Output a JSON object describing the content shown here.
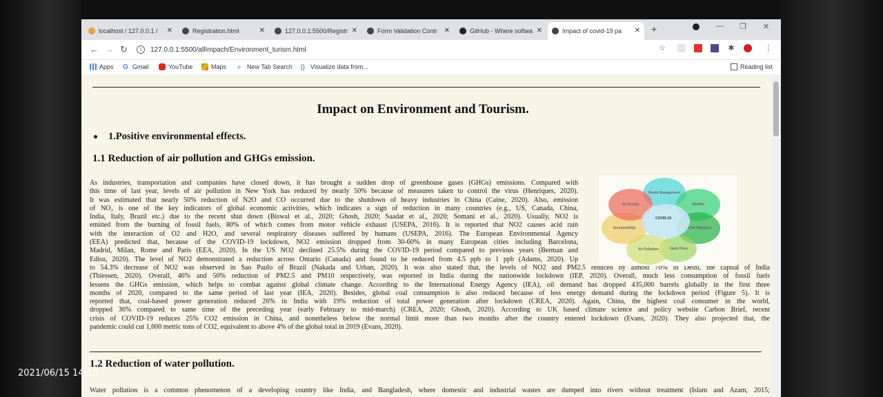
{
  "browser": {
    "tabs": [
      {
        "title": "localhost / 127.0.0.1 / ",
        "color": "#e8a33d"
      },
      {
        "title": "Registration.html",
        "color": "#444444"
      },
      {
        "title": "127.0.0.1:5500/Registr",
        "color": "#444444"
      },
      {
        "title": "Form Validation Contr",
        "color": "#444444"
      },
      {
        "title": "GitHub - Where softwa",
        "color": "#222222"
      },
      {
        "title": "Impact of covid-19 pa",
        "color": "#444444"
      }
    ],
    "url": "127.0.0.1:5500/allImpach/Environment_turism.html",
    "bookmarks": [
      {
        "label": "Apps",
        "icon": "apps-grid-icon"
      },
      {
        "label": "Gmail",
        "icon": "google-icon"
      },
      {
        "label": "YouTube",
        "icon": "youtube-icon"
      },
      {
        "label": "Maps",
        "icon": "maps-icon"
      },
      {
        "label": "New Tab Search",
        "icon": "search-icon"
      },
      {
        "label": "Visualize data from...",
        "icon": "brackets-icon"
      }
    ],
    "reading_list": "Reading list"
  },
  "page": {
    "title": "Impact on Environment and Tourism.",
    "bullet": "1.Positive environmental effects.",
    "section1_heading": "1.1 Reduction of air pollution and GHGs emission.",
    "section1_lines": [
      "As industries, transportation and companies have closed down, it has brought a sudden drop of greenhouse gases (GHGs) emissions. Compared with",
      "this time of last year, levels of air pollution in New York has reduced by nearly 50% because of measures taken to control the virus (Henriques, 2020).",
      "It was estimated that nearly 50% reduction of N2O and CO occurred due to the shutdown of heavy industries in China (Caine, 2020). Also, emission",
      "of NO₂ is one of the key indicators of global economic activities, which indicates a sign of reduction in many countries (e.g., US, Canada, China,",
      "India, Italy, Brazil etc.) due to the recent shut down (Biswal et al., 2020; Ghosh, 2020; Saadat et al., 2020; Somani et al., 2020). Usually, NO2 is",
      "emitted from the burning of fossil fuels, 80% of which comes from motor vehicle exhaust (USEPA, 2016). It is reported that NO2 causes acid rain",
      "with the interaction of O2 and H2O, and several respiratory diseases suffered by humans (USEPA, 2016). The European Environmental Agency",
      "(EEA) predicted that, because of the COVID-19 lockdown, NO2 emission dropped from 30-60% in many European cities including Barcelona,",
      "Madrid, Milan, Rome and Paris (EEA, 2020). In the US NO2 declined 25.5% during the COVID-19 period compared to previous years (Berman and",
      "Edisu, 2020). The level of NO2 demonstrated a reduction across Ontario (Canada) and found to be reduced from 4.5 ppb to 1 ppb (Adams, 2020). Up",
      "to 54.3% decrease of NO2 was observed in Sao Paulo of Brazil (Nakada and Urban, 2020). It was also stated that, the levels of NO2 and PM2.5 reduced by almost 70% in Delhi, the capital of India",
      "(Thiessen, 2020). Overall, 46% and 50% reduction of PM2.5 and PM10 respectively, was reported in India during the nationwide lockdown (IEP, 2020). Overall, much less consumption of fossil fuels",
      "lessens the GHGs emission, which helps to combat against global climate change. According to the International Energy Agency (IEA), oil demand has dropped 435,000 barrels globally in the first three",
      "months of 2020, compared to the same period of last year (IEA, 2020). Besides, global coal consumption is also reduced because of less energy demand during the lockdown period (Figure 5). It is",
      "reported that, coal-based power generation reduced 26% in India with 19% reduction of total power generation after lockdown (CREA, 2020). Again, China, the highest coal consumer in the world,",
      "dropped 36% compared to same time of the preceding year (early February to mid-march) (CREA, 2020; Ghosh, 2020). According to UK based climate science and policy website Carbon Brief, recent",
      "crisis of COVID-19 reduces 25% CO2 emission in China, and nonetheless below the normal limit more than two months after the country entered lockdown (Evans, 2020). They also projected that, the",
      "pandemic could cut 1,600 metric tons of CO2, equivalent to above 4% of the global total in 2019 (Evans, 2020)."
    ],
    "section2_heading": "1.2 Reduction of water pollution.",
    "section2_line": "Water pollution is a common phenomenon of a developing country like India, and Bangladesh, where domestic and industrial wastes are dumped into rivers without treatment (Islam and Azam, 2015;",
    "figure": {
      "center": "COVID-19",
      "petals": [
        "Waste Management",
        "Wildlife",
        "Global Migration",
        "Waste Fires",
        "Air Pollution",
        "Sustainability",
        "Air Quality"
      ]
    }
  },
  "overlay": {
    "timestamp": "2021/06/15 14:15"
  }
}
